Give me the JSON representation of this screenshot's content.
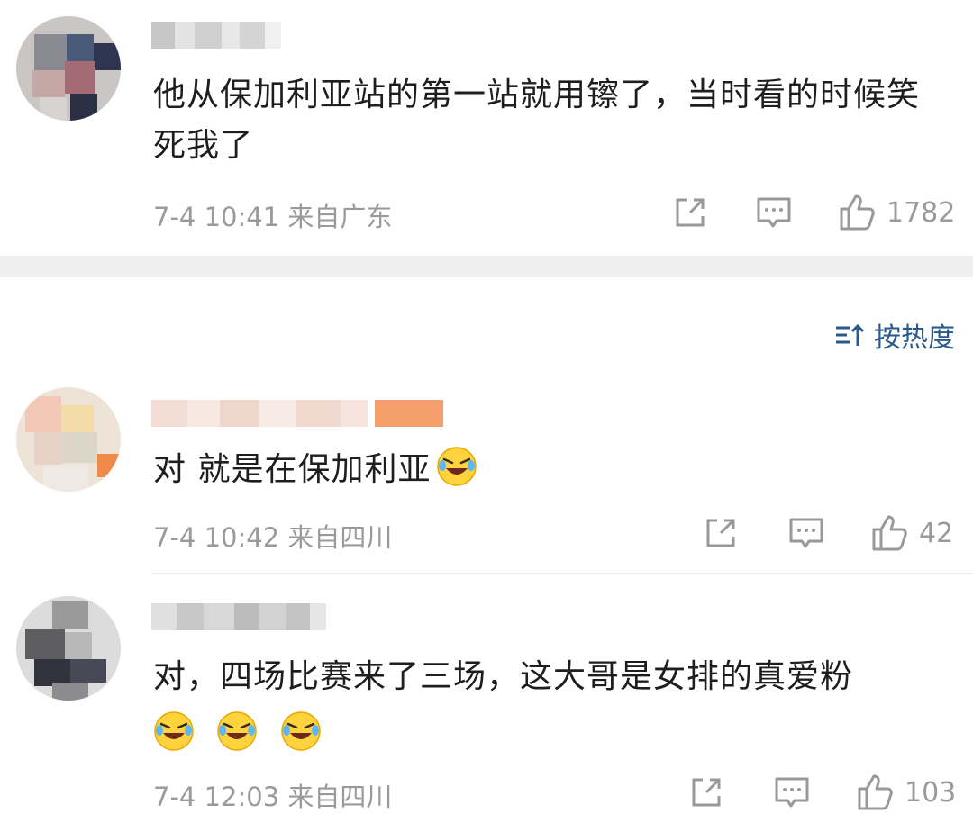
{
  "comments": [
    {
      "text": "他从保加利亚站的第一站就用镲了，当时看的时候笑死我了",
      "time": "7-4 10:41",
      "location": "来自广东",
      "likes": "1782",
      "emoji_count": 0
    },
    {
      "text": "对 就是在保加利亚",
      "time": "7-4 10:42",
      "location": "来自四川",
      "likes": "42",
      "emoji_count": 1
    },
    {
      "text": "对，四场比赛来了三场，这大哥是女排的真爱粉",
      "time": "7-4 12:03",
      "location": "来自四川",
      "likes": "103",
      "emoji_count": 3
    }
  ],
  "sort": {
    "label": "按热度",
    "icon": "sort-icon"
  },
  "icons": {
    "share": "share-icon",
    "reply": "comment-icon",
    "like": "thumbs-up-icon",
    "emoji": "laughing-tears-emoji"
  },
  "colors": {
    "sort_text": "#2b5a8f",
    "meta_text": "#9a9a9a",
    "gap": "#efefef"
  }
}
